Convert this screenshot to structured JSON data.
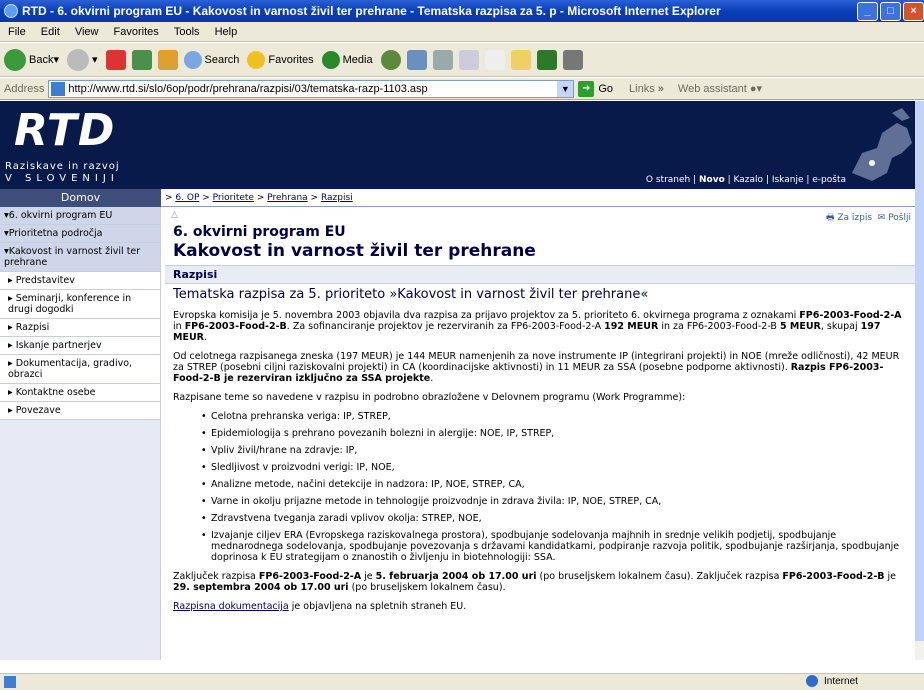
{
  "window": {
    "title": "RTD - 6. okvirni program EU - Kakovost in varnost živil ter prehrane - Tematska razpisa za 5. p - Microsoft Internet Explorer"
  },
  "menu": [
    "File",
    "Edit",
    "View",
    "Favorites",
    "Tools",
    "Help"
  ],
  "toolbar": {
    "back": "Back",
    "search": "Search",
    "favorites": "Favorites",
    "media": "Media"
  },
  "address": {
    "label": "Address",
    "url": "http://www.rtd.si/slo/6op/podr/prehrana/razpisi/03/tematska-razp-1103.asp",
    "go": "Go",
    "links": "Links",
    "web_assistant": "Web assistant"
  },
  "header": {
    "logo": "RTD",
    "sub1": "Raziskave in razvoj",
    "sub2": "V SLOVENIJI",
    "nav": [
      "O straneh",
      "Novo",
      "Kazalo",
      "Iskanje",
      "e-pošta"
    ]
  },
  "domov": "Domov",
  "breadcrumb": [
    "6. OP",
    "Prioritete",
    "Prehrana",
    "Razpisi"
  ],
  "sidebar": [
    {
      "label": "▾6. okvirni program EU",
      "type": "top"
    },
    {
      "label": "▾Prioritetna področja",
      "type": "top"
    },
    {
      "label": "▾Kakovost in varnost živil ter prehrane",
      "type": "top"
    },
    {
      "label": "▸ Predstavitev",
      "type": "sub"
    },
    {
      "label": "▸ Seminarji, konference in drugi dogodki",
      "type": "sub"
    },
    {
      "label": "▸ Razpisi",
      "type": "sub"
    },
    {
      "label": "▸ Iskanje partnerjev",
      "type": "sub"
    },
    {
      "label": "▸ Dokumentacija, gradivo, obrazci",
      "type": "sub"
    },
    {
      "label": "▸ Kontaktne osebe",
      "type": "sub"
    },
    {
      "label": "▸ Povezave",
      "type": "sub"
    }
  ],
  "print": {
    "print": "Za izpis",
    "send": "Pošlji"
  },
  "page": {
    "subtitle": "6. okvirni program EU",
    "title": "Kakovost in varnost živil ter prehrane",
    "section": "Razpisi",
    "heading": "Tematska razpisa za 5. prioriteto »Kakovost in varnost živil ter prehrane«",
    "p1a": "Evropska komisija je 5. novembra 2003 objavila dva razpisa za prijavo projektov za 5. prioriteto 6. okvirnega programa z oznakami ",
    "p1b": "FP6-2003-Food-2-A",
    "p1c": " in ",
    "p1d": "FP6-2003-Food-2-B",
    "p1e": ". Za sofinanciranje projektov je rezerviranih za FP6-2003-Food-2-A ",
    "p1f": "192 MEUR",
    "p1g": " in za FP6-2003-Food-2-B ",
    "p1h": "5 MEUR",
    "p1i": ", skupaj ",
    "p1j": "197 MEUR",
    "p1k": ".",
    "p2a": "Od celotnega razpisanega zneska (197 MEUR) je 144 MEUR namenjenih za nove instrumente IP (integrirani projekti) in NOE (mreže odličnosti), 42 MEUR za STREP (posebni ciljni raziskovalni projekti) in CA (koordinacijske aktivnosti) in 11 MEUR za SSA (posebne podporne aktivnosti). ",
    "p2b": "Razpis FP6-2003-Food-2-B je rezerviran izključno za SSA projekte",
    "p2c": ".",
    "p3": "Razpisane teme so navedene v razpisu in podrobno obrazložene v Delovnem programu (Work Programme):",
    "topics": [
      "Celotna prehranska veriga: IP, STREP,",
      "Epidemiologija s prehrano povezanih bolezni in alergije: NOE, IP, STREP,",
      "Vpliv živil/hrane na zdravje: IP,",
      "Sledljivost v proizvodni verigi: IP, NOE,",
      "Analizne metode, načini detekcije in nadzora: IP, NOE, STREP, CA,",
      "Varne in okolju prijazne metode in tehnologije proizvodnje in zdrava živila: IP, NOE, STREP, CA,",
      "Zdravstvena tveganja zaradi vplivov okolja: STREP, NOE,",
      "Izvajanje ciljev ERA (Evropskega raziskovalnega prostora), spodbujanje sodelovanja majhnih in srednje velikih podjetij, spodbujanje mednarodnega sodelovanja, spodbujanje povezovanja s državami kandidatkami, podpiranje razvoja politik, spodbujanje razširjanja, spodbujanje doprinosa k EU strategijam o znanostih o življenju in biotehnologiji: SSA."
    ],
    "p4a": "Zaključek razpisa ",
    "p4b": "FP6-2003-Food-2-A",
    "p4c": " je ",
    "p4d": "5. februarja 2004 ob 17.00 uri",
    "p4e": " (po bruseljskem lokalnem času). Zaključek razpisa ",
    "p4f": "FP6-2003-Food-2-B",
    "p4g": " je ",
    "p4h": "29. septembra 2004 ob 17.00 uri",
    "p4i": " (po bruseljskem lokalnem času).",
    "p5link": "Razpisna dokumentacija",
    "p5rest": " je objavljena na spletnih straneh EU."
  },
  "status": {
    "zone": "Internet"
  },
  "colors": {
    "header_bg": "#071a4a",
    "sidebar_bg": "#e7eaf4",
    "title_blue": "#00004a"
  }
}
